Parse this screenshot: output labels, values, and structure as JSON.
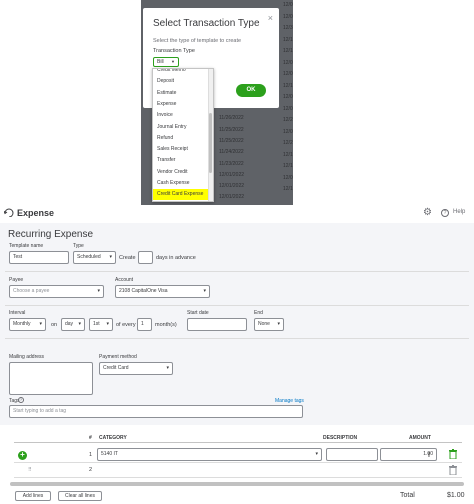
{
  "background_table": {
    "dates_right": [
      "12/0",
      "12/0",
      "12/3",
      "12/1",
      "12/1",
      "12/0",
      "12/0",
      "12/1",
      "12/0",
      "12/0",
      "12/2",
      "12/0",
      "12/2",
      "12/1",
      "12/1",
      "12/0",
      "12/1"
    ],
    "dates_left": [
      "11/29/2022",
      "11/26/2022",
      "11/25/2022",
      "11/25/2022",
      "11/24/2022",
      "11/23/2022",
      "12/01/2022",
      "12/01/2022",
      "12/01/2022"
    ]
  },
  "modal": {
    "title": "Select Transaction Type",
    "close": "×",
    "description": "Select the type of template to create",
    "type_label": "Transaction Type",
    "selected": "Bill",
    "ok_label": "OK"
  },
  "dropdown": {
    "items": [
      "Credit Memo",
      "Deposit",
      "Estimate",
      "Expense",
      "Invoice",
      "Journal Entry",
      "Refund",
      "Sales Receipt",
      "Transfer",
      "Vendor Credit",
      "Cash Expense",
      "Credit Card Expense"
    ],
    "highlighted_color": "#ffff00"
  },
  "header": {
    "title": "Expense",
    "help": "Help"
  },
  "form": {
    "section_title": "Recurring Expense",
    "template_name_label": "Template name",
    "template_name_value": "Test",
    "type_label": "Type",
    "type_value": "Scheduled",
    "create_label": "Create",
    "create_value": "",
    "days_advance": "days in advance",
    "payee_label": "Payee",
    "payee_placeholder": "Choose a payee",
    "account_label": "Account",
    "account_value": "2108 CapitalOne Visa",
    "interval_label": "Interval",
    "interval_value": "Monthly",
    "on_label": "on",
    "day_value": "day",
    "ordinal_value": "1st",
    "of_every": "of every",
    "months_value": "1",
    "months_label": "month(s)",
    "start_date_label": "Start date",
    "start_date_value": "",
    "end_label": "End",
    "end_value": "None",
    "mailing_label": "Mailing address",
    "payment_method_label": "Payment method",
    "payment_method_value": "Credit Card",
    "tags_label": "Tags",
    "tags_placeholder": "Start typing to add a tag",
    "manage_tags": "Manage tags"
  },
  "table": {
    "headers": {
      "num": "#",
      "category": "CATEGORY",
      "description": "DESCRIPTION",
      "amount": "AMOUNT"
    },
    "rows": [
      {
        "num": "1",
        "category": "5140 IT",
        "description": "",
        "amount": "1.00"
      },
      {
        "num": "2",
        "category": "",
        "description": "",
        "amount": ""
      }
    ],
    "add_lines": "Add lines",
    "clear_lines": "Clear all lines",
    "total_label": "Total",
    "total_value": "$1.00"
  },
  "colors": {
    "accent_green": "#2ca01c",
    "link_blue": "#0077c5",
    "overlay_gray": "#5f6267"
  }
}
